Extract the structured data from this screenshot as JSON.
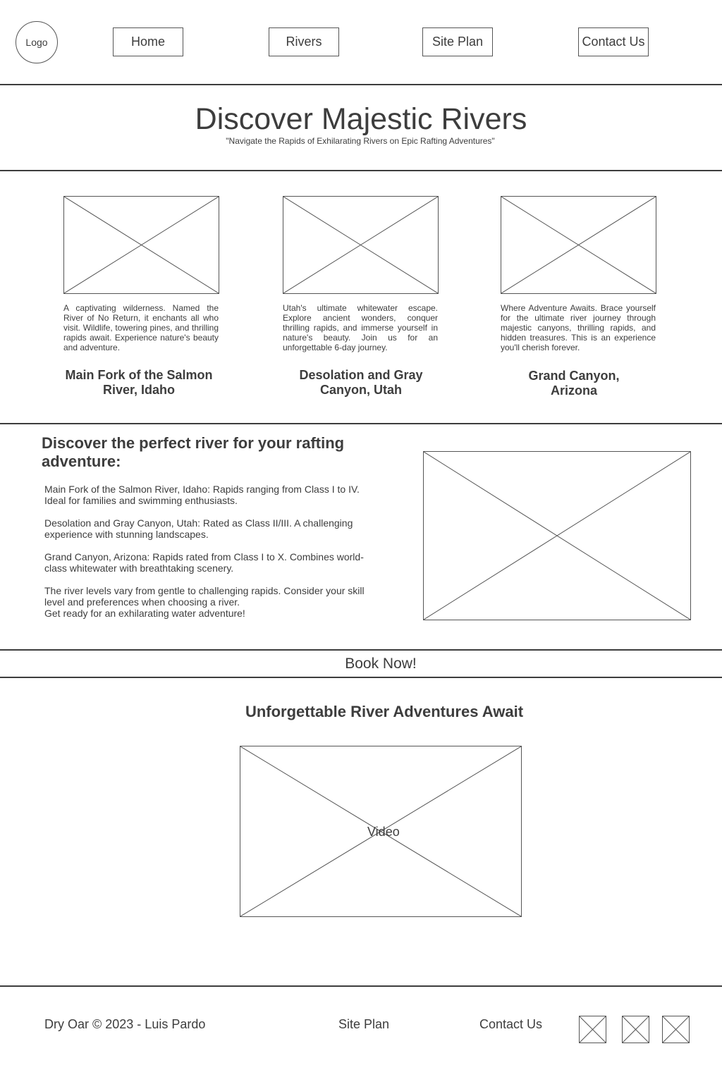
{
  "header": {
    "logo": "Logo",
    "nav": [
      "Home",
      "Rivers",
      "Site Plan",
      "Contact Us"
    ]
  },
  "hero": {
    "title": "Discover Majestic Rivers",
    "subtitle": "\"Navigate the Rapids of Exhilarating Rivers on Epic Rafting Adventures\""
  },
  "rivers": [
    {
      "description": "A captivating wilderness. Named the River of No Return, it enchants all who visit. Wildlife, towering pines, and thrilling rapids await. Experience nature's beauty and adventure.",
      "name": "Main Fork of the Salmon River, Idaho"
    },
    {
      "description": "Utah's ultimate whitewater escape. Explore ancient wonders, conquer thrilling rapids, and immerse yourself in nature's beauty. Join us for an unforgettable 6-day journey.",
      "name": "Desolation and Gray Canyon, Utah"
    },
    {
      "description": "Where Adventure Awaits. Brace yourself for the ultimate river journey through majestic canyons, thrilling rapids, and hidden treasures. This is an experience you'll cherish forever.",
      "name": "Grand Canyon, Arizona"
    }
  ],
  "discover": {
    "heading": "Discover the perfect river for your rafting adventure:",
    "paragraphs": [
      "Main Fork of the Salmon River, Idaho: Rapids ranging from Class I to IV. Ideal for families and swimming enthusiasts.",
      "Desolation and Gray Canyon, Utah: Rated as Class II/III. A challenging experience with stunning landscapes.",
      "Grand Canyon, Arizona: Rapids rated from Class I to X. Combines world-class whitewater with breathtaking scenery.",
      "The river levels vary from gentle to challenging rapids. Consider your skill level and preferences when choosing a river.",
      "Get ready for an exhilarating water adventure!"
    ]
  },
  "book_now": "Book Now!",
  "adventures": {
    "heading": "Unforgettable River Adventures Await",
    "video_label": "Video"
  },
  "footer": {
    "copyright": "Dry Oar © 2023 - Luis Pardo",
    "site_plan": "Site Plan",
    "contact": "Contact Us"
  },
  "colors": {
    "text": "#3d3d3d",
    "border": "#555555",
    "background": "#ffffff"
  },
  "icons": [
    "social-icon-1",
    "social-icon-2",
    "social-icon-3"
  ]
}
